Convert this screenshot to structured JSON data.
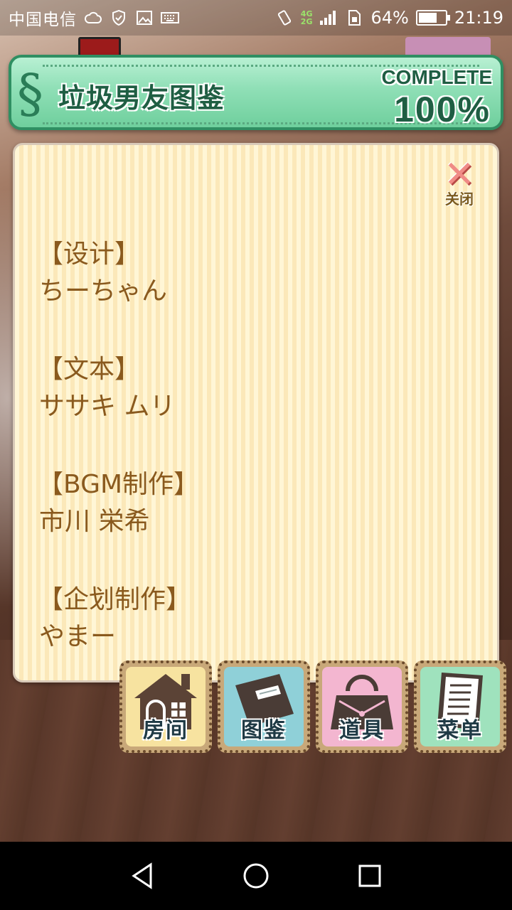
{
  "status_bar": {
    "carrier": "中国电信",
    "network_top": "4G",
    "network_bottom": "2G",
    "battery_percent": "64%",
    "battery_level": 0.64,
    "time": "21:19"
  },
  "banner": {
    "section_mark": "§",
    "title": "垃圾男友图鉴",
    "complete_label": "COMPLETE",
    "complete_value": "100%"
  },
  "panel": {
    "close_label": "关闭",
    "credits": [
      {
        "heading": "【设计】",
        "name": "ちーちゃん"
      },
      {
        "heading": "【文本】",
        "name": "ササキ ムリ"
      },
      {
        "heading": "【BGM制作】",
        "name": "市川 栄希"
      },
      {
        "heading": "【企划制作】",
        "name": "やまー"
      }
    ]
  },
  "nav_buttons": [
    {
      "label": "房间",
      "icon": "house-icon",
      "bg": "#f7e3a0"
    },
    {
      "label": "图鉴",
      "icon": "book-icon",
      "bg": "#8fd0d8"
    },
    {
      "label": "道具",
      "icon": "bag-icon",
      "bg": "#f3b6d0"
    },
    {
      "label": "菜单",
      "icon": "menu-list-icon",
      "bg": "#9fe2bd"
    }
  ],
  "colors": {
    "banner_green": "#8fdfb6",
    "text_brown": "#8a5a1e",
    "close_pink": "#f08b86"
  }
}
